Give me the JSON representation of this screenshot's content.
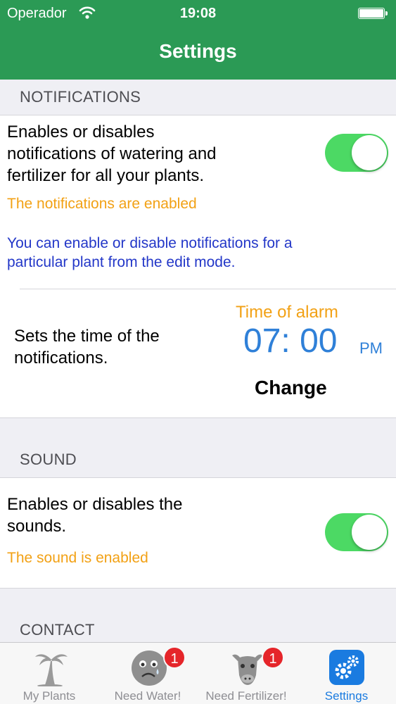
{
  "status_bar": {
    "carrier": "Operador",
    "time": "19:08"
  },
  "header": {
    "title": "Settings"
  },
  "notifications": {
    "section_title": "NOTIFICATIONS",
    "description": "Enables or disables notifications of watering and fertilizer for all your plants.",
    "description_lines": [
      "Enables or disables",
      "notifications of watering and",
      "fertilizer for all your plants."
    ],
    "status": "The notifications are enabled",
    "enabled": true,
    "hint_lines": [
      "You can enable or disable notifications for a",
      "particular plant from the edit mode."
    ],
    "time_desc_lines": [
      "Sets the time of the",
      "notifications."
    ],
    "alarm_label": "Time of alarm",
    "alarm_time": "07: 00",
    "alarm_ampm": "PM",
    "change_label": "Change"
  },
  "sound": {
    "section_title": "SOUND",
    "description_lines": [
      "Enables or disables the",
      "sounds."
    ],
    "status": "The sound is enabled",
    "enabled": true
  },
  "contact": {
    "section_title": "CONTACT"
  },
  "tabbar": {
    "tabs": [
      {
        "label": "My Plants",
        "icon": "palm-tree-icon",
        "badge": null
      },
      {
        "label": "Need Water!",
        "icon": "sad-face-icon",
        "badge": "1"
      },
      {
        "label": "Need Fertilizer!",
        "icon": "cow-icon",
        "badge": "1"
      },
      {
        "label": "Settings",
        "icon": "gears-icon",
        "badge": null,
        "active": true
      }
    ]
  },
  "colors": {
    "header_green": "#2b9a55",
    "toggle_on": "#4cd964",
    "status_orange": "#f2a115",
    "hint_blue": "#2337c8",
    "time_blue": "#2f80d8",
    "tab_active": "#1a7be0",
    "badge_red": "#e5252a"
  }
}
